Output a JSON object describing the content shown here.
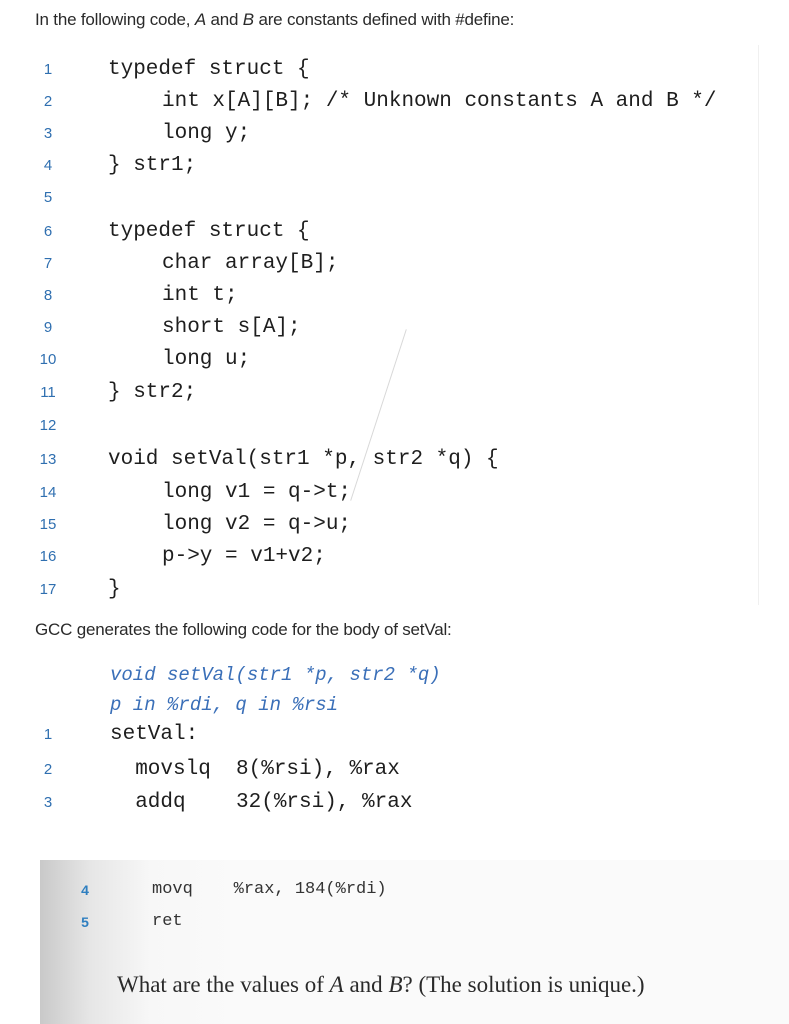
{
  "intro": {
    "prefix": "In the following code, ",
    "var_a": "A",
    "middle": " and ",
    "var_b": "B",
    "suffix": " are constants defined with #define:"
  },
  "c_code": {
    "lines": [
      {
        "num": "1",
        "text": "typedef struct {",
        "indent": 0
      },
      {
        "num": "2",
        "text": "int x[A][B]; /* Unknown constants A and B */",
        "indent": 1
      },
      {
        "num": "3",
        "text": "long y;",
        "indent": 1
      },
      {
        "num": "4",
        "text": "} str1;",
        "indent": 0
      },
      {
        "num": "5",
        "text": "",
        "indent": 0
      },
      {
        "num": "6",
        "text": "typedef struct {",
        "indent": 0
      },
      {
        "num": "7",
        "text": "char array[B];",
        "indent": 1
      },
      {
        "num": "8",
        "text": "int t;",
        "indent": 1
      },
      {
        "num": "9",
        "text": "short s[A];",
        "indent": 1
      },
      {
        "num": "10",
        "text": "long u;",
        "indent": 1
      },
      {
        "num": "11",
        "text": "} str2;",
        "indent": 0
      },
      {
        "num": "12",
        "text": "",
        "indent": 0
      },
      {
        "num": "13",
        "text": "void setVal(str1 *p, str2 *q) {",
        "indent": 0
      },
      {
        "num": "14",
        "text": "long v1 = q->t;",
        "indent": 1
      },
      {
        "num": "15",
        "text": "long v2 = q->u;",
        "indent": 1
      },
      {
        "num": "16",
        "text": "p->y = v1+v2;",
        "indent": 1
      },
      {
        "num": "17",
        "text": "}",
        "indent": 0
      }
    ]
  },
  "gcc_text": "GCC generates the following code for the body of setVal:",
  "asm": {
    "comment_signature": "void setVal(str1 *p, str2 *q)",
    "comment_registers": "p in %rdi, q in %rsi",
    "lines": [
      {
        "num": "1",
        "text": "setVal:"
      },
      {
        "num": "2",
        "text": "  movslq  8(%rsi), %rax"
      },
      {
        "num": "3",
        "text": "  addq    32(%rsi), %rax"
      }
    ],
    "scanned_lines": [
      {
        "num": "4",
        "text": "movq    %rax, 184(%rdi)"
      },
      {
        "num": "5",
        "text": "ret"
      }
    ]
  },
  "question": {
    "prefix": "What are the values of ",
    "var_a": "A",
    "middle": " and ",
    "var_b": "B",
    "suffix": "? (The solution is unique.)"
  },
  "colors": {
    "line_number": "#2f6fb0",
    "asm_comment": "#3a6fb8"
  }
}
